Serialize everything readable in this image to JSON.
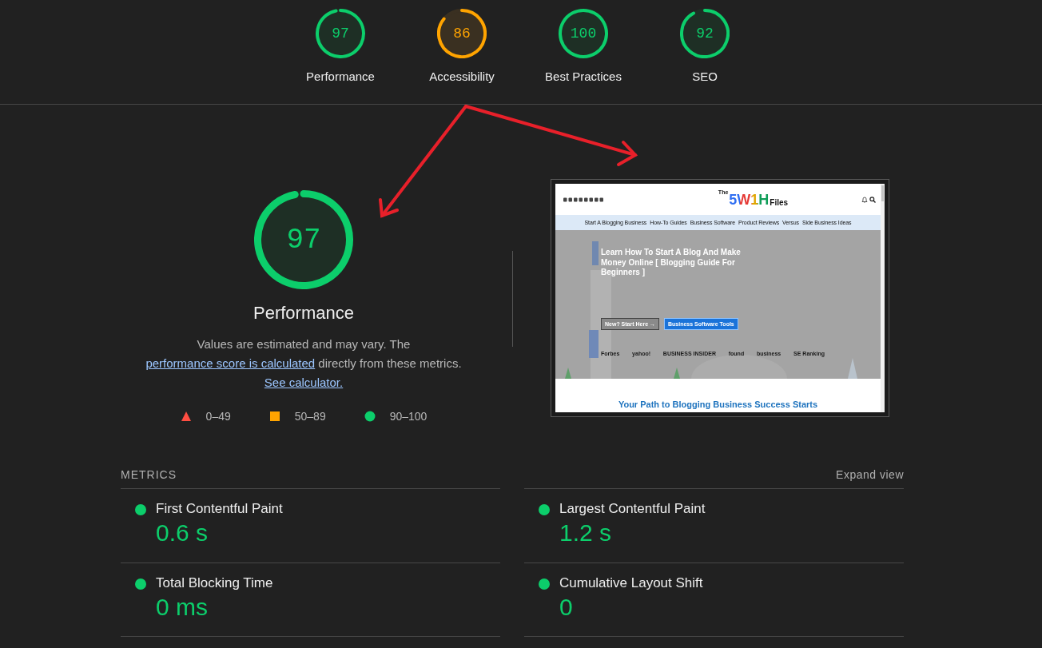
{
  "categories": [
    {
      "score": "97",
      "label": "Performance"
    },
    {
      "score": "86",
      "label": "Accessibility"
    },
    {
      "score": "100",
      "label": "Best Practices"
    },
    {
      "score": "92",
      "label": "SEO"
    }
  ],
  "performance": {
    "score": "97",
    "title": "Performance",
    "note": {
      "before": "Values are estimated and may vary. The ",
      "link": "performance score is calculated",
      "middle": " directly from these metrics. ",
      "link2": "See calculator."
    }
  },
  "legend": [
    {
      "kind": "triangle",
      "color": "#ff4e42",
      "range": "0–49"
    },
    {
      "kind": "square",
      "color": "#ffa400",
      "range": "50–89"
    },
    {
      "kind": "circle",
      "color": "#0cce6b",
      "range": "90–100"
    }
  ],
  "screenshot": {
    "logo": {
      "top": "The",
      "mark": "5W1H",
      "name": "Files"
    },
    "nav": [
      "Start A Blogging Business",
      "How-To Guides",
      "Business Software",
      "Product Reviews",
      "Versus",
      "Side Business Ideas"
    ],
    "hero": {
      "title": "Learn How To Start A Blog And Make Money Online [ Blogging Guide For Beginners ]",
      "buttons": [
        "New? Start Here →",
        "Business Software Tools"
      ]
    },
    "logos": [
      "Forbes",
      "yahoo!",
      "BUSINESS INSIDER",
      "found",
      "business",
      "SE Ranking"
    ],
    "section_heading": "Your Path to Blogging Business Success Starts"
  },
  "metrics": {
    "title": "METRICS",
    "expand": "Expand view",
    "items": [
      {
        "label": "First Contentful Paint",
        "value": "0.6 s",
        "color": "#0cce6b"
      },
      {
        "label": "Largest Contentful Paint",
        "value": "1.2 s",
        "color": "#0cce6b"
      },
      {
        "label": "Total Blocking Time",
        "value": "0 ms",
        "color": "#0cce6b"
      },
      {
        "label": "Cumulative Layout Shift",
        "value": "0",
        "color": "#0cce6b"
      }
    ]
  }
}
